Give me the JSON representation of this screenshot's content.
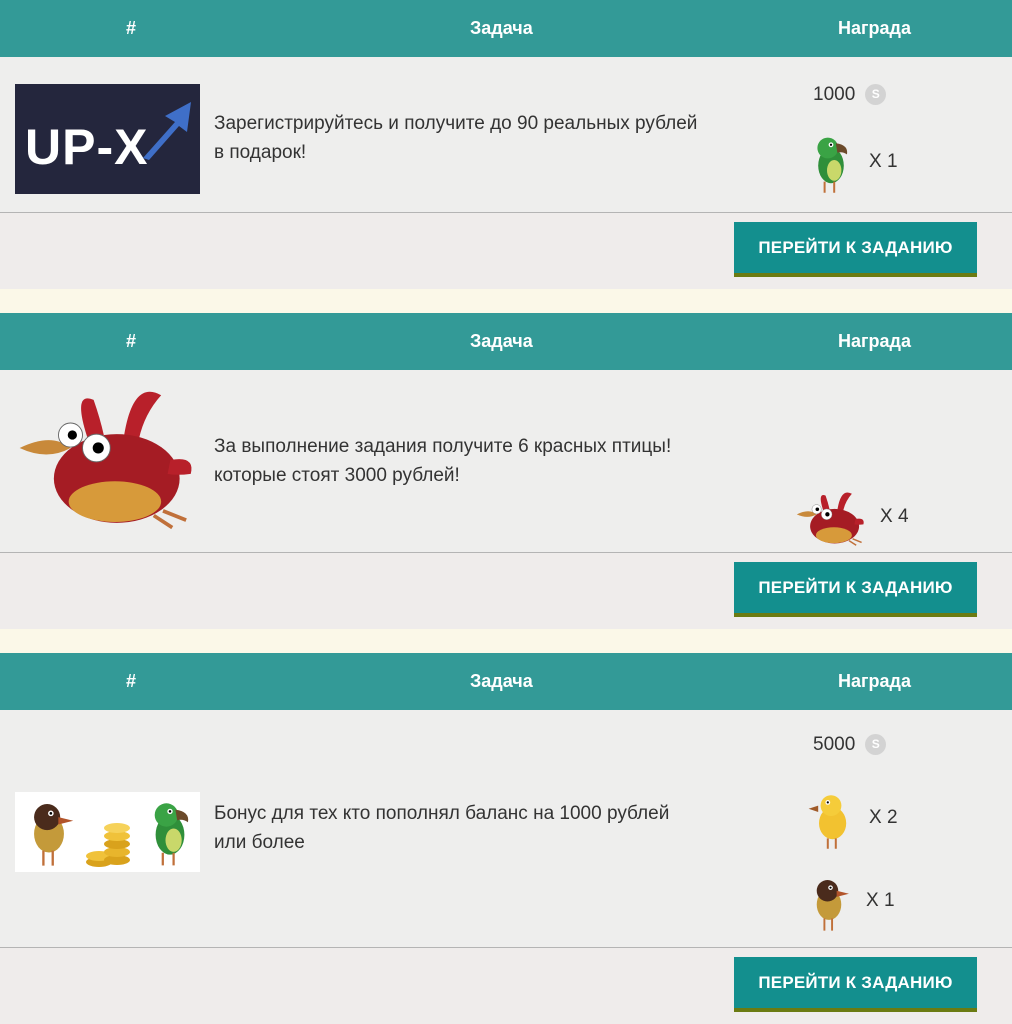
{
  "header": {
    "num": "#",
    "task": "Задача",
    "reward": "Награда"
  },
  "tasks": [
    {
      "logo_text": "UP-X",
      "description": "Зарегистрируйтесь и получите до 90 реальных рублей в подарок!",
      "coins": "1000",
      "coin_icon": "S",
      "rewards": [
        {
          "icon": "green-parrot-icon",
          "qty": "X 1"
        }
      ],
      "button": "ПЕРЕЙТИ К ЗАДАНИЮ"
    },
    {
      "description": "За выполнение задания получите 6 красных птицы! которые стоят 3000 рублей!",
      "rewards": [
        {
          "icon": "red-bird-icon",
          "qty": "X 4"
        }
      ],
      "button": "ПЕРЕЙТИ К ЗАДАНИЮ"
    },
    {
      "description": "Бонус для тех кто пополнял баланс на 1000 рублей или более",
      "coins": "5000",
      "coin_icon": "S",
      "rewards": [
        {
          "icon": "yellow-bird-icon",
          "qty": "X 2"
        },
        {
          "icon": "brown-bird-icon",
          "qty": "X 1"
        }
      ],
      "button": "ПЕРЕЙТИ К ЗАДАНИЮ"
    }
  ],
  "colors": {
    "header": "#339a97",
    "button": "#138f8e",
    "button_shadow": "#6b7b12",
    "card": "#eeeeed",
    "page": "#fbf8e8"
  }
}
